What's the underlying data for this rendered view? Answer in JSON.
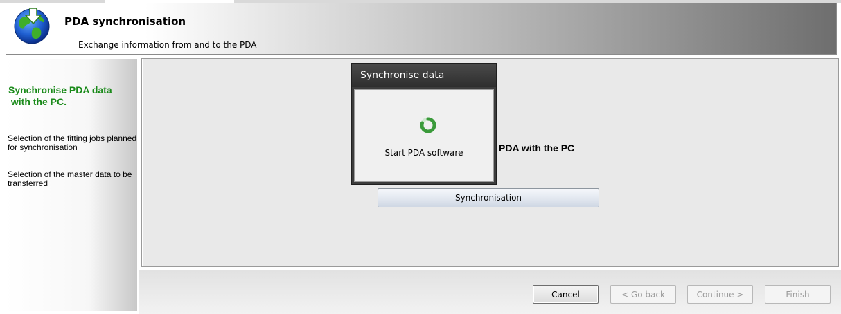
{
  "header": {
    "title": "PDA synchronisation",
    "subtitle": "Exchange information from and to the PDA"
  },
  "sidebar": {
    "title": "Synchronise PDA data\n with the PC.",
    "items": [
      "Selection of the fitting jobs planned for synchronisation",
      "Selection of the master data to be transferred"
    ]
  },
  "main": {
    "text": "PDA with the PC",
    "sync_button": "Synchronisation"
  },
  "dialog": {
    "title": "Synchronise data",
    "message": "Start PDA software"
  },
  "footer": {
    "cancel": "Cancel",
    "go_back": "< Go back",
    "continue": "Continue >",
    "finish": "Finish"
  },
  "colors": {
    "accent_green": "#1a8a1a",
    "dialog_dark": "#3c3c3c"
  }
}
